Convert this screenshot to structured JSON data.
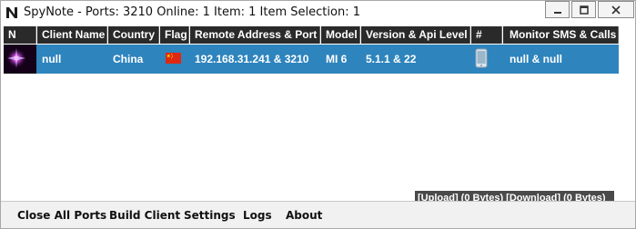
{
  "window": {
    "title": "SpyNote - Ports: 3210 Online: 1 Item: 1 Item Selection: 1",
    "app_icon": "spynote-logo-icon"
  },
  "table": {
    "columns": [
      "N",
      "Client Name",
      "Country",
      "Flag",
      "Remote Address & Port",
      "Model",
      "Version & Api Level",
      "#",
      "Monitor SMS & Calls"
    ],
    "rows": [
      {
        "avatar": "android-avatar-icon",
        "client_name": "null",
        "country": "China",
        "flag": "china-flag-icon",
        "remote_address": "192.168.31.241 & 3210",
        "model": "MI 6",
        "version_api": "5.1.1 & 22",
        "device": "phone-icon",
        "monitor": "null & null"
      }
    ]
  },
  "transfer_status": "[Upload] (0 Bytes) [Download] (0 Bytes)",
  "bottom_menu": [
    "Close All Ports",
    "Build Client",
    "Settings",
    "Logs",
    "About"
  ],
  "colors": {
    "header_bg": "#2a2a2a",
    "selected_row": "#2e84bd",
    "transfer_bg": "#4a4a4a"
  }
}
